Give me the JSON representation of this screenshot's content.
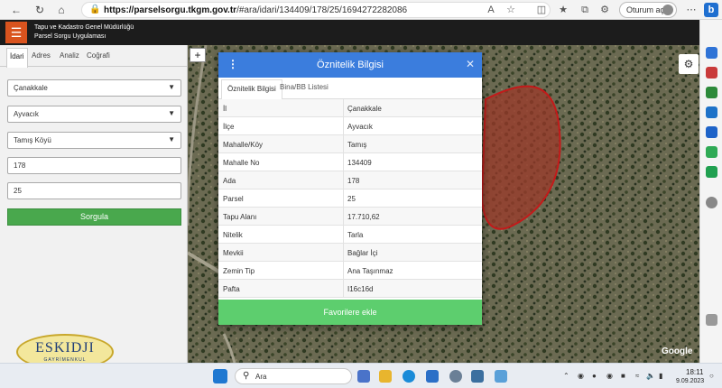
{
  "browser": {
    "url_host": "https://parselsorgu.tkgm.gov.tr",
    "url_path": "/#ara/idari/134409/178/25/1694272282086",
    "profile_label": "Oturum aç"
  },
  "app": {
    "title_line1": "Tapu ve Kadastro Genel Müdürlüğü",
    "title_line2": "Parsel Sorgu Uygulaması"
  },
  "left_panel": {
    "tabs": [
      "İdari",
      "Adres",
      "Analiz",
      "Coğrafi"
    ],
    "province": "Çanakkale",
    "district": "Ayvacık",
    "village": "Tamış Köyü",
    "ada": "178",
    "parsel": "25",
    "search_label": "Sorgula"
  },
  "dialog": {
    "title": "Öznitelik Bilgisi",
    "tabs": [
      "Öznitelik Bilgisi",
      "Bina/BB Listesi"
    ],
    "rows": [
      {
        "key": "İl",
        "value": "Çanakkale"
      },
      {
        "key": "İlçe",
        "value": "Ayvacık"
      },
      {
        "key": "Mahalle/Köy",
        "value": "Tamış"
      },
      {
        "key": "Mahalle No",
        "value": "134409"
      },
      {
        "key": "Ada",
        "value": "178"
      },
      {
        "key": "Parsel",
        "value": "25"
      },
      {
        "key": "Tapu Alanı",
        "value": "17.710,62"
      },
      {
        "key": "Nitelik",
        "value": "Tarla"
      },
      {
        "key": "Mevkii",
        "value": "Bağlar İçi"
      },
      {
        "key": "Zemin Tip",
        "value": "Ana Taşınmaz"
      },
      {
        "key": "Pafta",
        "value": "I16c16d"
      }
    ],
    "favorite_label": "Favorilere ekle"
  },
  "map": {
    "google_label": "Google",
    "zoom_in_label": "+"
  },
  "watermark": {
    "main": "ESKIDJI",
    "sub": "GAYRİMENKUL"
  },
  "taskbar": {
    "search_placeholder": "Ara",
    "time": "18:11",
    "date": "9.09.2023"
  }
}
